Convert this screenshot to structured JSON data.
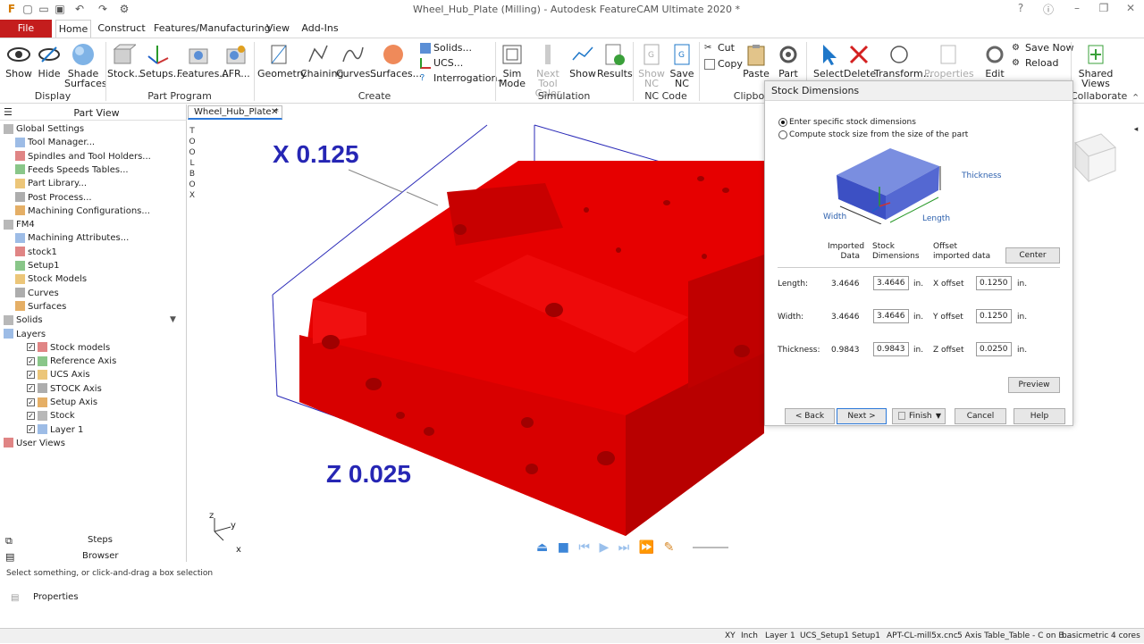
{
  "window": {
    "title": "Wheel_Hub_Plate (Milling) - Autodesk FeatureCAM Ultimate 2020 *",
    "controls": [
      "?",
      "–",
      "❐",
      "✕"
    ]
  },
  "menu_tabs": [
    "File",
    "Home",
    "Construct",
    "Features/Manufacturing",
    "View",
    "Add-Ins"
  ],
  "ribbon": {
    "display": {
      "label": "Display",
      "buttons": [
        "Show",
        "Hide",
        "Shade\nSurfaces"
      ]
    },
    "part_program": {
      "label": "Part Program",
      "buttons": [
        "Stock...",
        "Setups...",
        "Features...",
        "AFR..."
      ]
    },
    "create": {
      "label": "Create",
      "buttons": [
        "Geometry",
        "Chaining",
        "Curves...",
        "Surfaces..."
      ],
      "small": [
        "Solids...",
        "UCS...",
        "Interrogation..."
      ]
    },
    "simulation": {
      "label": "Simulation",
      "buttons": [
        "Sim\nMode",
        "Next Tool\nColor",
        "Show",
        "Results"
      ]
    },
    "nc_code": {
      "label": "NC Code",
      "buttons": [
        "Show\nNC",
        "Save\nNC"
      ]
    },
    "clipboard": {
      "label": "Clipboa",
      "small": [
        "Cut",
        "Copy"
      ],
      "buttons": [
        "Paste",
        "Part"
      ]
    },
    "edit_group": {
      "buttons": [
        "Select",
        "Delete",
        "Transform...",
        "Properties"
      ]
    },
    "file_group": {
      "buttons": [
        "Edit"
      ],
      "small": [
        "Save Now",
        "Reload"
      ]
    },
    "collaborate": {
      "label": "Collaborate",
      "buttons": [
        "Shared\nViews"
      ]
    }
  },
  "left_panel": {
    "title": "Part View",
    "tree": [
      {
        "label": "Global Settings",
        "indent": 0
      },
      {
        "label": "Tool Manager...",
        "indent": 1
      },
      {
        "label": "Spindles and Tool Holders...",
        "indent": 1
      },
      {
        "label": "Feeds Speeds Tables...",
        "indent": 1
      },
      {
        "label": "Part Library...",
        "indent": 1
      },
      {
        "label": "Post Process...",
        "indent": 1
      },
      {
        "label": "Machining Configurations...",
        "indent": 1
      },
      {
        "label": "FM4",
        "indent": 0
      },
      {
        "label": "Machining Attributes...",
        "indent": 1
      },
      {
        "label": "stock1",
        "indent": 1
      },
      {
        "label": "Setup1",
        "indent": 1
      },
      {
        "label": "Stock Models",
        "indent": 1
      },
      {
        "label": "Curves",
        "indent": 1
      },
      {
        "label": "Surfaces",
        "indent": 1
      },
      {
        "label": "Solids",
        "indent": 0
      },
      {
        "label": "Layers",
        "indent": 0
      },
      {
        "label": "Stock models",
        "indent": 2
      },
      {
        "label": "Reference Axis",
        "indent": 2
      },
      {
        "label": "UCS Axis",
        "indent": 2
      },
      {
        "label": "STOCK Axis",
        "indent": 2
      },
      {
        "label": "Setup Axis",
        "indent": 2
      },
      {
        "label": "Stock",
        "indent": 2
      },
      {
        "label": "Layer 1",
        "indent": 2
      },
      {
        "label": "User Views",
        "indent": 0
      }
    ],
    "bottom_tabs": [
      "Steps",
      "Browser"
    ]
  },
  "doc_tab": "Wheel_Hub_Plate *",
  "side_toolbox": "TOOLBOX",
  "viewport": {
    "x_label": "X 0.125",
    "z_label": "Z 0.025",
    "part_color": "#e60000",
    "axis_labels": [
      "z",
      "y",
      "x"
    ]
  },
  "dialog": {
    "title": "Stock Dimensions",
    "radio1": "Enter specific stock dimensions",
    "radio2": "Compute stock size from the size of the part",
    "thickness_label": "Thickness",
    "width_label": "Width",
    "length_label": "Length",
    "col_imported": "Imported\nData",
    "col_stock": "Stock\nDimensions",
    "col_offset": "Offset\nimported data",
    "center_btn": "Center",
    "rows": [
      {
        "label": "Length:",
        "imported": "3.4646",
        "value": "3.4646",
        "unit": "in.",
        "offset_label": "X offset",
        "offset": "0.1250"
      },
      {
        "label": "Width:",
        "imported": "3.4646",
        "value": "3.4646",
        "unit": "in.",
        "offset_label": "Y offset",
        "offset": "0.1250"
      },
      {
        "label": "Thickness:",
        "imported": "0.9843",
        "value": "0.9843",
        "unit": "in.",
        "offset_label": "Z offset",
        "offset": "0.0250"
      }
    ],
    "preview_btn": "Preview",
    "back_btn": "< Back",
    "next_btn": "Next >",
    "finish_btn": "Finish",
    "cancel_btn": "Cancel",
    "help_btn": "Help"
  },
  "status_line": "Select something, or click-and-drag a box selection",
  "properties_label": "Properties",
  "status_bar": [
    "XY",
    "Inch",
    "Layer 1",
    "UCS_Setup1",
    "Setup1",
    "APT-CL-mill5x.cnc",
    "5 Axis Table_Table - C on B...",
    "basicmetric",
    "4 cores"
  ]
}
